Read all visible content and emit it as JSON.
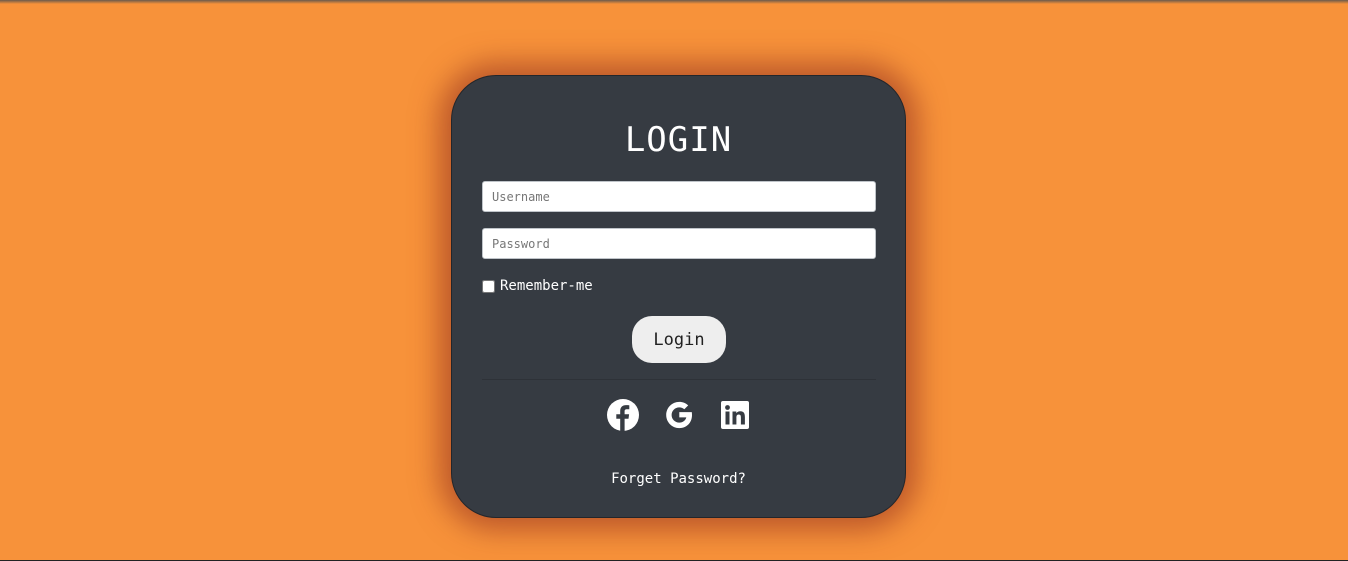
{
  "login_form": {
    "title": "LOGIN",
    "username": {
      "placeholder": "Username",
      "value": ""
    },
    "password": {
      "placeholder": "Password",
      "value": ""
    },
    "remember_label": "Remember-me",
    "remember_checked": false,
    "submit_label": "Login",
    "social_icons": [
      "facebook-icon",
      "google-icon",
      "linkedin-icon"
    ],
    "forget_password_label": "Forget Password?"
  },
  "colors": {
    "page_background": "#f7923a",
    "card_background": "#363b42",
    "button_background": "#eeeeee",
    "text": "#ffffff"
  }
}
